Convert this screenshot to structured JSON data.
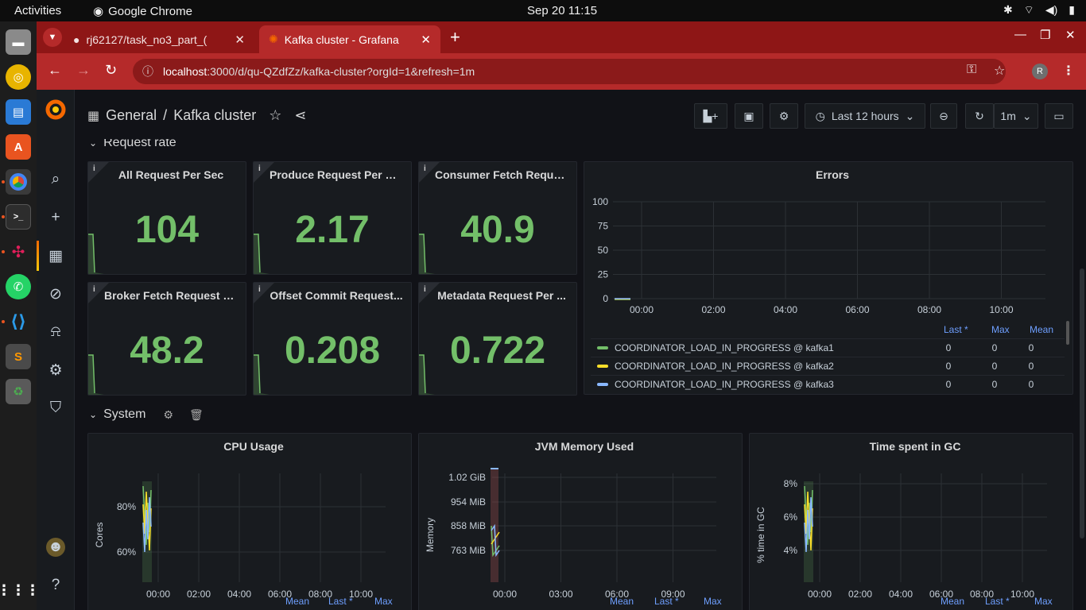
{
  "os": {
    "activities": "Activities",
    "app_name": "Google Chrome",
    "clock": "Sep 20  11:15"
  },
  "browser": {
    "tabs": [
      {
        "title": "rj62127/task_no3_part_(",
        "icon": "github-icon"
      },
      {
        "title": "Kafka cluster - Grafana",
        "icon": "grafana-icon"
      }
    ],
    "url_host": "localhost",
    "url_path": ":3000/d/qu-QZdfZz/kafka-cluster?orgId=1&refresh=1m",
    "profile_initial": "R"
  },
  "grafana": {
    "breadcrumb": {
      "folder": "General",
      "separator": "/",
      "dashboard": "Kafka cluster"
    },
    "time_range": "Last 12 hours",
    "refresh": "1m",
    "rows": [
      {
        "title": "Request rate"
      },
      {
        "title": "System"
      }
    ],
    "stats": [
      {
        "title": "All Request Per Sec",
        "value": "104"
      },
      {
        "title": "Produce Request Per Sec",
        "value": "2.17"
      },
      {
        "title": "Consumer Fetch Reque...",
        "value": "40.9"
      },
      {
        "title": "Broker Fetch Request P...",
        "value": "48.2"
      },
      {
        "title": "Offset Commit Request...",
        "value": "0.208"
      },
      {
        "title": "Metadata Request Per ...",
        "value": "0.722"
      }
    ],
    "errors_panel": {
      "title": "Errors",
      "legend_headers": [
        "Last *",
        "Max",
        "Mean"
      ],
      "series": [
        {
          "name": "COORDINATOR_LOAD_IN_PROGRESS @ kafka1",
          "color": "#73bf69",
          "last": "0",
          "max": "0",
          "mean": "0"
        },
        {
          "name": "COORDINATOR_LOAD_IN_PROGRESS @ kafka2",
          "color": "#fade2a",
          "last": "0",
          "max": "0",
          "mean": "0"
        },
        {
          "name": "COORDINATOR_LOAD_IN_PROGRESS @ kafka3",
          "color": "#8ab8ff",
          "last": "0",
          "max": "0",
          "mean": "0"
        }
      ]
    },
    "system_panels": [
      {
        "title": "CPU Usage",
        "ylabel": "Cores",
        "legend_headers": [
          "Mean",
          "Last *",
          "Max"
        ]
      },
      {
        "title": "JVM Memory Used",
        "ylabel": "Memory",
        "legend_headers": [
          "Mean",
          "Last *",
          "Max"
        ]
      },
      {
        "title": "Time spent in GC",
        "ylabel": "% time in GC",
        "legend_headers": [
          "Mean",
          "Last *",
          "Max"
        ]
      }
    ]
  },
  "chart_data": [
    {
      "type": "line",
      "title": "Errors",
      "x_ticks": [
        "00:00",
        "02:00",
        "04:00",
        "06:00",
        "08:00",
        "10:00"
      ],
      "y_ticks": [
        "0",
        "25",
        "50",
        "75",
        "100"
      ],
      "ylim": [
        0,
        100
      ],
      "series": [
        {
          "name": "COORDINATOR_LOAD_IN_PROGRESS @ kafka1",
          "values": [
            0,
            0
          ]
        },
        {
          "name": "COORDINATOR_LOAD_IN_PROGRESS @ kafka2",
          "values": [
            0,
            0
          ]
        },
        {
          "name": "COORDINATOR_LOAD_IN_PROGRESS @ kafka3",
          "values": [
            0,
            0
          ]
        }
      ]
    },
    {
      "type": "line",
      "title": "CPU Usage",
      "ylabel": "Cores",
      "x_ticks": [
        "00:00",
        "02:00",
        "04:00",
        "06:00",
        "08:00",
        "10:00"
      ],
      "y_ticks": [
        "60%",
        "80%"
      ]
    },
    {
      "type": "line",
      "title": "JVM Memory Used",
      "ylabel": "Memory",
      "x_ticks": [
        "00:00",
        "03:00",
        "06:00",
        "09:00"
      ],
      "y_ticks": [
        "763 MiB",
        "858 MiB",
        "954 MiB",
        "1.02 GiB"
      ]
    },
    {
      "type": "line",
      "title": "Time spent in GC",
      "ylabel": "% time in GC",
      "x_ticks": [
        "00:00",
        "02:00",
        "04:00",
        "06:00",
        "08:00",
        "10:00"
      ],
      "y_ticks": [
        "4%",
        "6%",
        "8%"
      ]
    }
  ]
}
